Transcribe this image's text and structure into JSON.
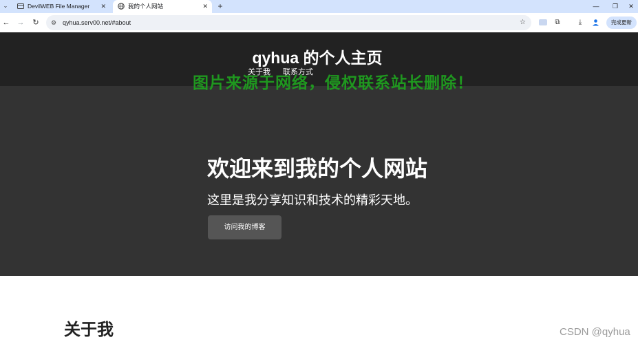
{
  "browser": {
    "tabs": [
      {
        "title": "DevilWEB File Manager - pul",
        "active": false
      },
      {
        "title": "我的个人网站",
        "active": true
      }
    ],
    "url": "qyhua.serv00.net/#about",
    "update_label": "完成更新"
  },
  "site": {
    "title": "qyhua 的个人主页",
    "nav": [
      "关于我",
      "联系方式"
    ],
    "watermark": "图片来源于网络，侵权联系站长删除！",
    "hero": {
      "title": "欢迎来到我的个人网站",
      "subtitle": "这里是我分享知识和技术的精彩天地。",
      "button": "访问我的博客"
    },
    "about_title": "关于我"
  },
  "credit": "CSDN @qyhua",
  "colors": {
    "tabbar": "#d3e3fd",
    "header_bg": "#222222",
    "hero_bg": "#333333",
    "button_bg": "#555555",
    "watermark": "#1fa11f"
  }
}
